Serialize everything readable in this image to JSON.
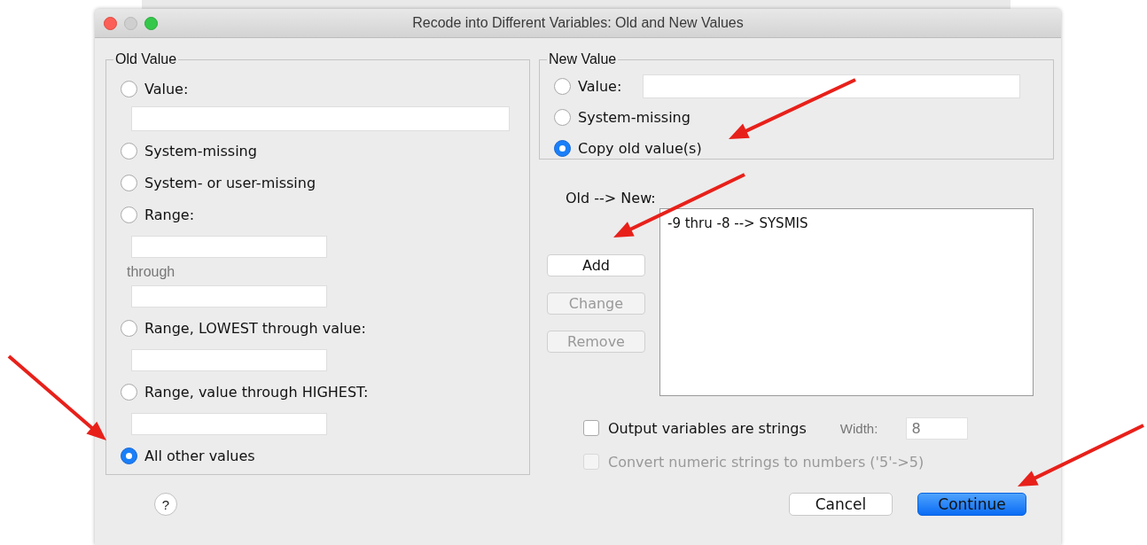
{
  "window": {
    "title": "Recode into Different Variables: Old and New Values"
  },
  "old_value": {
    "title": "Old Value",
    "options": [
      {
        "kind": "wide-field",
        "label": "Value:",
        "selected": false
      },
      {
        "kind": "plain",
        "label": "System-missing",
        "selected": false
      },
      {
        "kind": "plain",
        "label": "System- or user-missing",
        "selected": false
      },
      {
        "kind": "range",
        "label": "Range:",
        "through": "through",
        "selected": false
      },
      {
        "kind": "field",
        "label": "Range, LOWEST through value:",
        "selected": false
      },
      {
        "kind": "field",
        "label": "Range, value through HIGHEST:",
        "selected": false
      },
      {
        "kind": "plain",
        "label": "All other values",
        "selected": true
      }
    ]
  },
  "new_value": {
    "title": "New Value",
    "options": [
      {
        "kind": "inline-field",
        "label": "Value:",
        "selected": false
      },
      {
        "kind": "plain",
        "label": "System-missing",
        "selected": false
      },
      {
        "kind": "plain",
        "label": "Copy old value(s)",
        "selected": true
      }
    ]
  },
  "mapping": {
    "label": "Old --> New:",
    "items": [
      "-9 thru -8 --> SYSMIS"
    ]
  },
  "buttons": [
    {
      "label": "Add",
      "disabled": false
    },
    {
      "label": "Change",
      "disabled": true
    },
    {
      "label": "Remove",
      "disabled": true
    }
  ],
  "checkboxes": [
    {
      "label": "Output variables are strings",
      "checked": false,
      "disabled": false
    },
    {
      "label": "Convert numeric strings to numbers ('5'->5)",
      "checked": false,
      "disabled": true
    }
  ],
  "width": {
    "label": "Width:",
    "value": "8"
  },
  "help": "?",
  "footer_buttons": [
    {
      "label": "Cancel",
      "default": false
    },
    {
      "label": "Continue",
      "default": true
    }
  ]
}
